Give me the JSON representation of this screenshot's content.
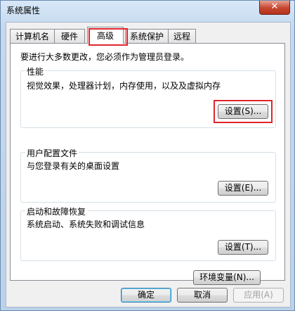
{
  "window": {
    "title": "系统属性",
    "close_label": "✕"
  },
  "tabs": [
    {
      "label": "计算机名"
    },
    {
      "label": "硬件"
    },
    {
      "label": "高级"
    },
    {
      "label": "系统保护"
    },
    {
      "label": "远程"
    }
  ],
  "advanced": {
    "admin_note": "要进行大多数更改，您必须作为管理员登录。",
    "performance": {
      "title": "性能",
      "description": "视觉效果，处理器计划，内存使用，以及及虚拟内存",
      "button": "设置(S)..."
    },
    "user_profiles": {
      "title": "用户配置文件",
      "description": "与您登录有关的桌面设置",
      "button": "设置(E)..."
    },
    "startup_recovery": {
      "title": "启动和故障恢复",
      "description": "系统启动、系统失败和调试信息",
      "button": "设置(T)..."
    },
    "env_button": "环境变量(N)..."
  },
  "footer": {
    "ok": "确定",
    "cancel": "取消",
    "apply": "应用(A)"
  },
  "colors": {
    "highlight": "#e0252b"
  }
}
